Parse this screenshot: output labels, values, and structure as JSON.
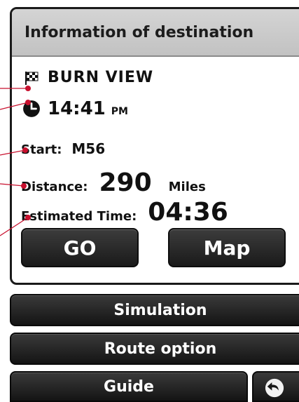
{
  "header": {
    "title": "Information of destination"
  },
  "destination": {
    "name": "BURN VIEW",
    "flag_icon": "checkered-flag-icon",
    "clock_icon": "clock-icon",
    "arrival_time": "14:41",
    "arrival_ampm": "PM"
  },
  "route": {
    "start_label": "Start:",
    "start_value": "M56",
    "distance_label": "Distance:",
    "distance_value": "290",
    "distance_unit": "Miles",
    "estimated_label": "Estimated Time:",
    "estimated_value": "04:36"
  },
  "actions": {
    "go_label": "GO",
    "map_label": "Map"
  },
  "menu": {
    "simulation_label": "Simulation",
    "route_option_label": "Route option",
    "guide_label": "Guide",
    "back_icon": "back-arrow-icon"
  },
  "colors": {
    "button_dark": "#1a1a1a",
    "header_gray": "#c8c8c8",
    "callout_red": "#c8102e"
  }
}
